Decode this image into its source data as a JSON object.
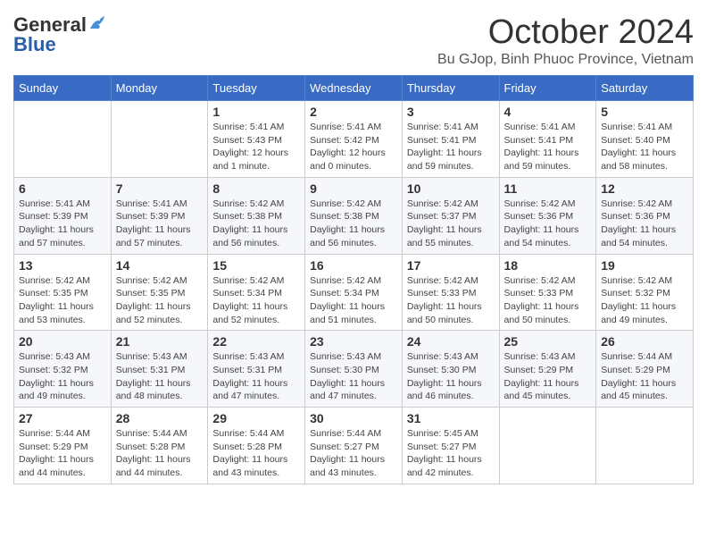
{
  "header": {
    "logo_general": "General",
    "logo_blue": "Blue",
    "title": "October 2024",
    "location": "Bu GJop, Binh Phuoc Province, Vietnam"
  },
  "days_of_week": [
    "Sunday",
    "Monday",
    "Tuesday",
    "Wednesday",
    "Thursday",
    "Friday",
    "Saturday"
  ],
  "weeks": [
    [
      {
        "day": "",
        "sunrise": "",
        "sunset": "",
        "daylight": ""
      },
      {
        "day": "",
        "sunrise": "",
        "sunset": "",
        "daylight": ""
      },
      {
        "day": "1",
        "sunrise": "Sunrise: 5:41 AM",
        "sunset": "Sunset: 5:43 PM",
        "daylight": "Daylight: 12 hours and 1 minute."
      },
      {
        "day": "2",
        "sunrise": "Sunrise: 5:41 AM",
        "sunset": "Sunset: 5:42 PM",
        "daylight": "Daylight: 12 hours and 0 minutes."
      },
      {
        "day": "3",
        "sunrise": "Sunrise: 5:41 AM",
        "sunset": "Sunset: 5:41 PM",
        "daylight": "Daylight: 11 hours and 59 minutes."
      },
      {
        "day": "4",
        "sunrise": "Sunrise: 5:41 AM",
        "sunset": "Sunset: 5:41 PM",
        "daylight": "Daylight: 11 hours and 59 minutes."
      },
      {
        "day": "5",
        "sunrise": "Sunrise: 5:41 AM",
        "sunset": "Sunset: 5:40 PM",
        "daylight": "Daylight: 11 hours and 58 minutes."
      }
    ],
    [
      {
        "day": "6",
        "sunrise": "Sunrise: 5:41 AM",
        "sunset": "Sunset: 5:39 PM",
        "daylight": "Daylight: 11 hours and 57 minutes."
      },
      {
        "day": "7",
        "sunrise": "Sunrise: 5:41 AM",
        "sunset": "Sunset: 5:39 PM",
        "daylight": "Daylight: 11 hours and 57 minutes."
      },
      {
        "day": "8",
        "sunrise": "Sunrise: 5:42 AM",
        "sunset": "Sunset: 5:38 PM",
        "daylight": "Daylight: 11 hours and 56 minutes."
      },
      {
        "day": "9",
        "sunrise": "Sunrise: 5:42 AM",
        "sunset": "Sunset: 5:38 PM",
        "daylight": "Daylight: 11 hours and 56 minutes."
      },
      {
        "day": "10",
        "sunrise": "Sunrise: 5:42 AM",
        "sunset": "Sunset: 5:37 PM",
        "daylight": "Daylight: 11 hours and 55 minutes."
      },
      {
        "day": "11",
        "sunrise": "Sunrise: 5:42 AM",
        "sunset": "Sunset: 5:36 PM",
        "daylight": "Daylight: 11 hours and 54 minutes."
      },
      {
        "day": "12",
        "sunrise": "Sunrise: 5:42 AM",
        "sunset": "Sunset: 5:36 PM",
        "daylight": "Daylight: 11 hours and 54 minutes."
      }
    ],
    [
      {
        "day": "13",
        "sunrise": "Sunrise: 5:42 AM",
        "sunset": "Sunset: 5:35 PM",
        "daylight": "Daylight: 11 hours and 53 minutes."
      },
      {
        "day": "14",
        "sunrise": "Sunrise: 5:42 AM",
        "sunset": "Sunset: 5:35 PM",
        "daylight": "Daylight: 11 hours and 52 minutes."
      },
      {
        "day": "15",
        "sunrise": "Sunrise: 5:42 AM",
        "sunset": "Sunset: 5:34 PM",
        "daylight": "Daylight: 11 hours and 52 minutes."
      },
      {
        "day": "16",
        "sunrise": "Sunrise: 5:42 AM",
        "sunset": "Sunset: 5:34 PM",
        "daylight": "Daylight: 11 hours and 51 minutes."
      },
      {
        "day": "17",
        "sunrise": "Sunrise: 5:42 AM",
        "sunset": "Sunset: 5:33 PM",
        "daylight": "Daylight: 11 hours and 50 minutes."
      },
      {
        "day": "18",
        "sunrise": "Sunrise: 5:42 AM",
        "sunset": "Sunset: 5:33 PM",
        "daylight": "Daylight: 11 hours and 50 minutes."
      },
      {
        "day": "19",
        "sunrise": "Sunrise: 5:42 AM",
        "sunset": "Sunset: 5:32 PM",
        "daylight": "Daylight: 11 hours and 49 minutes."
      }
    ],
    [
      {
        "day": "20",
        "sunrise": "Sunrise: 5:43 AM",
        "sunset": "Sunset: 5:32 PM",
        "daylight": "Daylight: 11 hours and 49 minutes."
      },
      {
        "day": "21",
        "sunrise": "Sunrise: 5:43 AM",
        "sunset": "Sunset: 5:31 PM",
        "daylight": "Daylight: 11 hours and 48 minutes."
      },
      {
        "day": "22",
        "sunrise": "Sunrise: 5:43 AM",
        "sunset": "Sunset: 5:31 PM",
        "daylight": "Daylight: 11 hours and 47 minutes."
      },
      {
        "day": "23",
        "sunrise": "Sunrise: 5:43 AM",
        "sunset": "Sunset: 5:30 PM",
        "daylight": "Daylight: 11 hours and 47 minutes."
      },
      {
        "day": "24",
        "sunrise": "Sunrise: 5:43 AM",
        "sunset": "Sunset: 5:30 PM",
        "daylight": "Daylight: 11 hours and 46 minutes."
      },
      {
        "day": "25",
        "sunrise": "Sunrise: 5:43 AM",
        "sunset": "Sunset: 5:29 PM",
        "daylight": "Daylight: 11 hours and 45 minutes."
      },
      {
        "day": "26",
        "sunrise": "Sunrise: 5:44 AM",
        "sunset": "Sunset: 5:29 PM",
        "daylight": "Daylight: 11 hours and 45 minutes."
      }
    ],
    [
      {
        "day": "27",
        "sunrise": "Sunrise: 5:44 AM",
        "sunset": "Sunset: 5:29 PM",
        "daylight": "Daylight: 11 hours and 44 minutes."
      },
      {
        "day": "28",
        "sunrise": "Sunrise: 5:44 AM",
        "sunset": "Sunset: 5:28 PM",
        "daylight": "Daylight: 11 hours and 44 minutes."
      },
      {
        "day": "29",
        "sunrise": "Sunrise: 5:44 AM",
        "sunset": "Sunset: 5:28 PM",
        "daylight": "Daylight: 11 hours and 43 minutes."
      },
      {
        "day": "30",
        "sunrise": "Sunrise: 5:44 AM",
        "sunset": "Sunset: 5:27 PM",
        "daylight": "Daylight: 11 hours and 43 minutes."
      },
      {
        "day": "31",
        "sunrise": "Sunrise: 5:45 AM",
        "sunset": "Sunset: 5:27 PM",
        "daylight": "Daylight: 11 hours and 42 minutes."
      },
      {
        "day": "",
        "sunrise": "",
        "sunset": "",
        "daylight": ""
      },
      {
        "day": "",
        "sunrise": "",
        "sunset": "",
        "daylight": ""
      }
    ]
  ]
}
